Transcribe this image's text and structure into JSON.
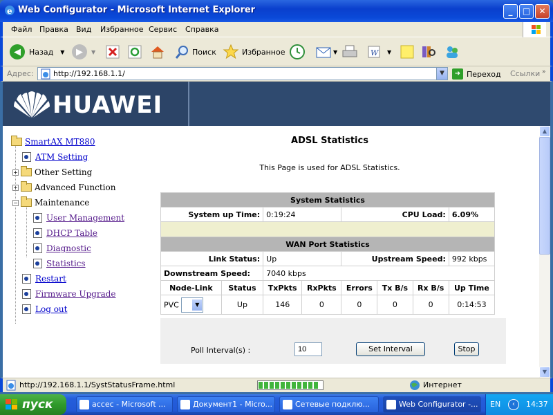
{
  "window": {
    "title": "Web Configurator - Microsoft Internet Explorer",
    "min": "_",
    "max": "□",
    "close": "✕"
  },
  "menu": [
    "Файл",
    "Правка",
    "Вид",
    "Избранное",
    "Сервис",
    "Справка"
  ],
  "toolbar": {
    "back": "Назад",
    "search": "Поиск",
    "favorites": "Избранное"
  },
  "address": {
    "label": "Адрес:",
    "url": "http://192.168.1.1/",
    "go": "Переход",
    "links": "Ссылки"
  },
  "banner": {
    "brand": "HUAWEI"
  },
  "sidebar": {
    "root": "SmartAX MT880",
    "atm": "ATM Setting",
    "other": "Other Setting",
    "advanced": "Advanced Function",
    "maintenance": "Maintenance",
    "user_mgmt": "User Management",
    "dhcp": "DHCP Table",
    "diagnostic": "Diagnostic",
    "statistics": "Statistics",
    "restart": "Restart",
    "firmware": "Firmware Upgrade",
    "logout": "Log out"
  },
  "main": {
    "title": "ADSL Statistics",
    "subtitle": "This Page is used for ADSL Statistics.",
    "system_header": "System Statistics",
    "uptime_label": "System up Time:",
    "uptime_value": "0:19:24",
    "cpu_label": "CPU Load:",
    "cpu_value": "6.09%",
    "wan_header": "WAN Port Statistics",
    "link_label": "Link Status:",
    "link_value": "Up",
    "upstream_label": "Upstream Speed:",
    "upstream_value": "992 kbps",
    "downstream_label": "Downstream Speed:",
    "downstream_value": "7040 kbps",
    "columns": [
      "Node-Link",
      "Status",
      "TxPkts",
      "RxPkts",
      "Errors",
      "Tx B/s",
      "Rx B/s",
      "Up Time"
    ],
    "row": {
      "node": "PVC",
      "status": "Up",
      "txpkts": "146",
      "rxpkts": "0",
      "errors": "0",
      "txbs": "0",
      "rxbs": "0",
      "uptime": "0:14:53"
    },
    "poll_label": "Poll Interval(s) :",
    "poll_value": "10",
    "set_interval": "Set Interval",
    "stop": "Stop"
  },
  "status": {
    "text": "http://192.168.1.1/SystStatusFrame.html",
    "zone": "Интернет"
  },
  "taskbar": {
    "start": "пуск",
    "tasks": [
      "accec - Microsoft ...",
      "Документ1 - Micro...",
      "Сетевые подклю...",
      "Web Configurator -..."
    ],
    "lang": "EN",
    "clock": "14:37"
  }
}
